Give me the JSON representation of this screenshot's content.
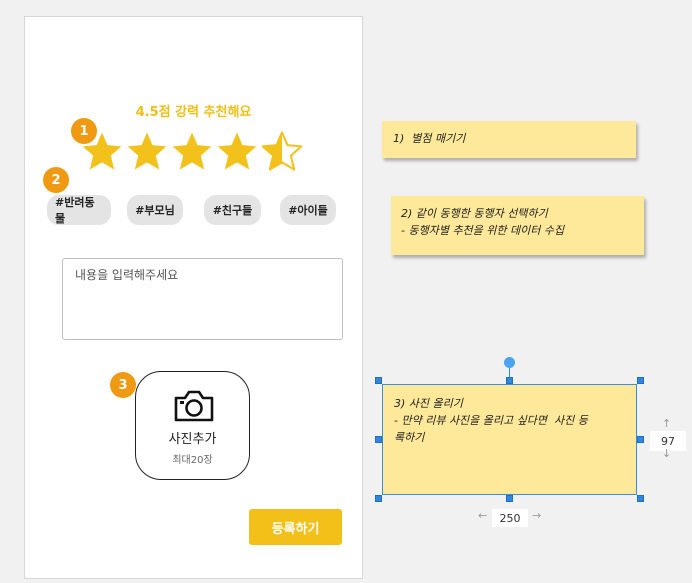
{
  "app": {
    "rating_title": "4.5점 강력 추천해요",
    "rating_value": 4.5,
    "rating_max": 5,
    "badges": [
      "1",
      "2",
      "3"
    ],
    "tags": [
      "#반려동물",
      "#부모님",
      "#친구들",
      "#아이들"
    ],
    "review_placeholder": "내용을 입력해주세요",
    "photo": {
      "icon": "camera-icon",
      "label": "사진추가",
      "sub": "최대20장"
    },
    "submit_label": "등록하기"
  },
  "notes": [
    {
      "lines": [
        "1)  별점 매기기"
      ]
    },
    {
      "lines": [
        "2) 같이 동행한 동행자 선택하기",
        "- 동행자별 추천을 위한 데이터 수집"
      ]
    },
    {
      "lines": [
        "3) 사진 올리기",
        "- 만약 리뷰 사진을 올리고 싶다면  사진 등",
        "록하기"
      ]
    }
  ],
  "selection": {
    "width_readout": "250",
    "height_readout": "97"
  },
  "colors": {
    "accent": "#f2c018",
    "badge": "#ef9a12",
    "note": "#fee99a",
    "selection": "#2f87df"
  }
}
